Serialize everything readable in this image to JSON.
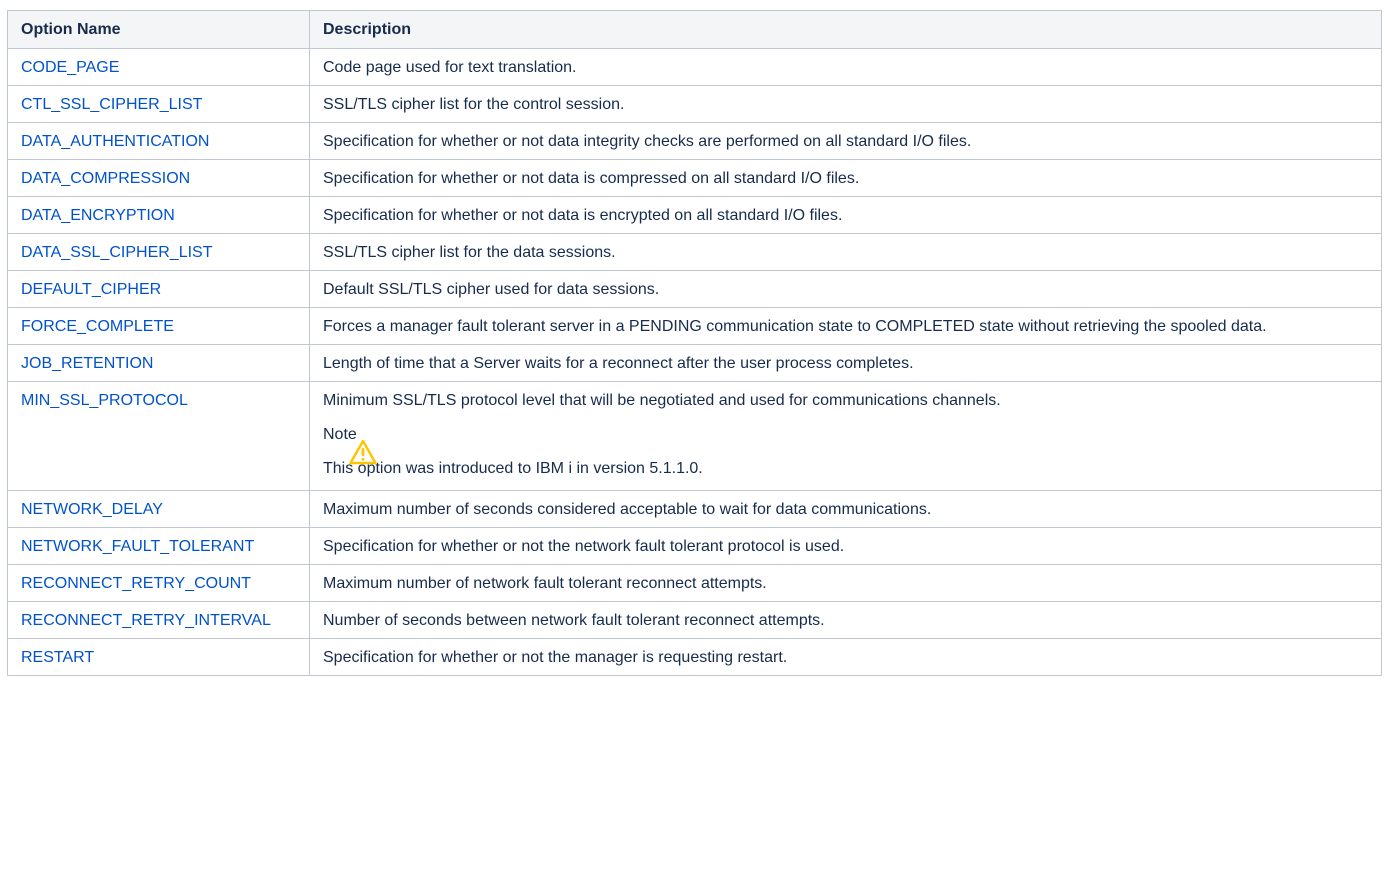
{
  "table": {
    "headers": {
      "name": "Option Name",
      "description": "Description"
    },
    "rows": [
      {
        "name": "CODE_PAGE",
        "description": "Code page used for text translation."
      },
      {
        "name": "CTL_SSL_CIPHER_LIST",
        "description": "SSL/TLS cipher list for the control session."
      },
      {
        "name": "DATA_AUTHENTICATION",
        "description": "Specification for whether or not data integrity checks are performed on all standard I/O files."
      },
      {
        "name": "DATA_COMPRESSION",
        "description": "Specification for whether or not data is compressed on all standard I/O files."
      },
      {
        "name": "DATA_ENCRYPTION",
        "description": "Specification for whether or not data is encrypted on all standard I/O files."
      },
      {
        "name": "DATA_SSL_CIPHER_LIST",
        "description": "SSL/TLS cipher list for the data sessions."
      },
      {
        "name": "DEFAULT_CIPHER",
        "description": "Default SSL/TLS cipher used for data sessions."
      },
      {
        "name": "FORCE_COMPLETE",
        "description": "Forces a manager fault tolerant server in a PENDING communication state to COMPLETED state without retrieving the spooled data."
      },
      {
        "name": "JOB_RETENTION",
        "description": "Length of time that a Server waits for a reconnect after the user process completes."
      },
      {
        "name": "MIN_SSL_PROTOCOL",
        "description": "Minimum SSL/TLS protocol level that will be negotiated and used for communications channels.",
        "note_label": "Note",
        "note_body": "This option was introduced to IBM i in version 5.1.1.0."
      },
      {
        "name": "NETWORK_DELAY",
        "description": "Maximum number of seconds considered acceptable to wait for data communications."
      },
      {
        "name": "NETWORK_FAULT_TOLERANT",
        "description": "Specification for whether or not the network fault tolerant protocol is used."
      },
      {
        "name": "RECONNECT_RETRY_COUNT",
        "description": "Maximum number of network fault tolerant reconnect attempts."
      },
      {
        "name": "RECONNECT_RETRY_INTERVAL",
        "description": "Number of seconds between network fault tolerant reconnect attempts."
      },
      {
        "name": "RESTART",
        "description": "Specification for whether or not the manager is requesting restart."
      }
    ]
  },
  "note_icon": "warning-icon",
  "colors": {
    "link": "#0052cc",
    "border": "#c1c7d0",
    "header_bg": "#f4f5f7",
    "warning": "#ffc400"
  }
}
